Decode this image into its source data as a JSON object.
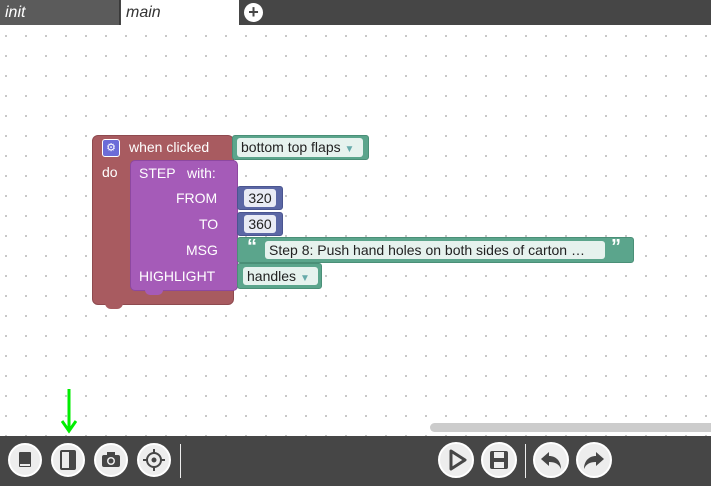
{
  "tabs": [
    {
      "label": "init",
      "active": false
    },
    {
      "label": "main",
      "active": true
    }
  ],
  "add_tab_icon": "plus-circle-icon",
  "hat_block": {
    "event_label": "when clicked",
    "event_value": "bottom top flaps",
    "do_label": "do"
  },
  "step_block": {
    "title": "STEP",
    "with_label": "with:",
    "params": {
      "from_label": "FROM",
      "from_value": "320",
      "to_label": "TO",
      "to_value": "360",
      "msg_label": "MSG",
      "msg_value": "Step 8: Push hand holes on both sides of carton …",
      "highlight_label": "HIGHLIGHT",
      "highlight_value": "handles"
    }
  },
  "toolbar": {
    "left_buttons": [
      "book-icon",
      "split-panel-icon",
      "camera-icon",
      "crosshair-icon"
    ],
    "right_buttons": [
      "play-icon",
      "save-icon",
      "undo-icon",
      "redo-icon"
    ]
  },
  "colors": {
    "hat": "#a85b60",
    "step": "#a55bb8",
    "teal": "#5ba58c",
    "number": "#5b67a5",
    "toolbar": "#464646",
    "indicator_arrow": "#00ee00"
  }
}
